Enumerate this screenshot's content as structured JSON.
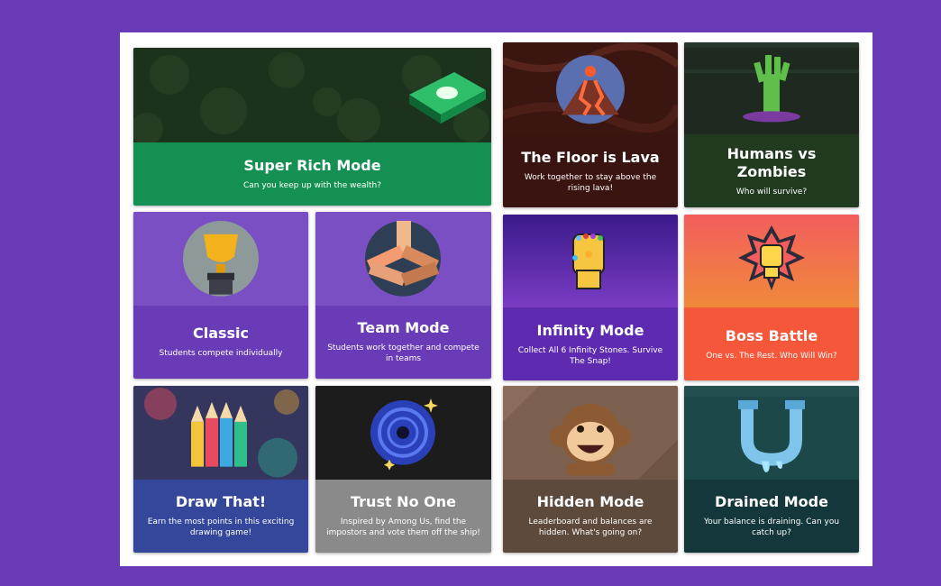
{
  "modes": [
    {
      "title": "Super Rich Mode",
      "desc": "Can you keep up with the wealth?",
      "icon": "money-stack-icon",
      "color": "#149152"
    },
    {
      "title": "The Floor is Lava",
      "desc": "Work together to stay above the rising lava!",
      "icon": "volcano-icon",
      "color": "#3a1410"
    },
    {
      "title": "Humans vs Zombies",
      "desc": "Who will survive?",
      "icon": "zombie-hand-icon",
      "color": "#223a20"
    },
    {
      "title": "Classic",
      "desc": "Students compete individually",
      "icon": "trophy-icon",
      "color": "#6a3bb6"
    },
    {
      "title": "Team Mode",
      "desc": "Students work together and compete in teams",
      "icon": "team-hands-icon",
      "color": "#6a3bb6"
    },
    {
      "title": "Infinity Mode",
      "desc": "Collect All 6 Infinity Stones. Survive The Snap!",
      "icon": "infinity-gauntlet-icon",
      "color": "#5e2bb0"
    },
    {
      "title": "Boss Battle",
      "desc": "One vs. The Rest. Who Will Win?",
      "icon": "fist-icon",
      "color": "#f4573a"
    },
    {
      "title": "Draw That!",
      "desc": "Earn the most points in this exciting drawing game!",
      "icon": "pencils-icon",
      "color": "#34479a"
    },
    {
      "title": "Trust No One",
      "desc": "Inspired by Among Us, find the impostors and vote them off the ship!",
      "icon": "black-hole-icon",
      "color": "#8a8a8a"
    },
    {
      "title": "Hidden Mode",
      "desc": "Leaderboard and balances are hidden. What's going on?",
      "icon": "monkey-icon",
      "color": "#5d4a3d"
    },
    {
      "title": "Drained Mode",
      "desc": "Your balance is draining. Can you catch up?",
      "icon": "pipe-icon",
      "color": "#13373a"
    }
  ]
}
